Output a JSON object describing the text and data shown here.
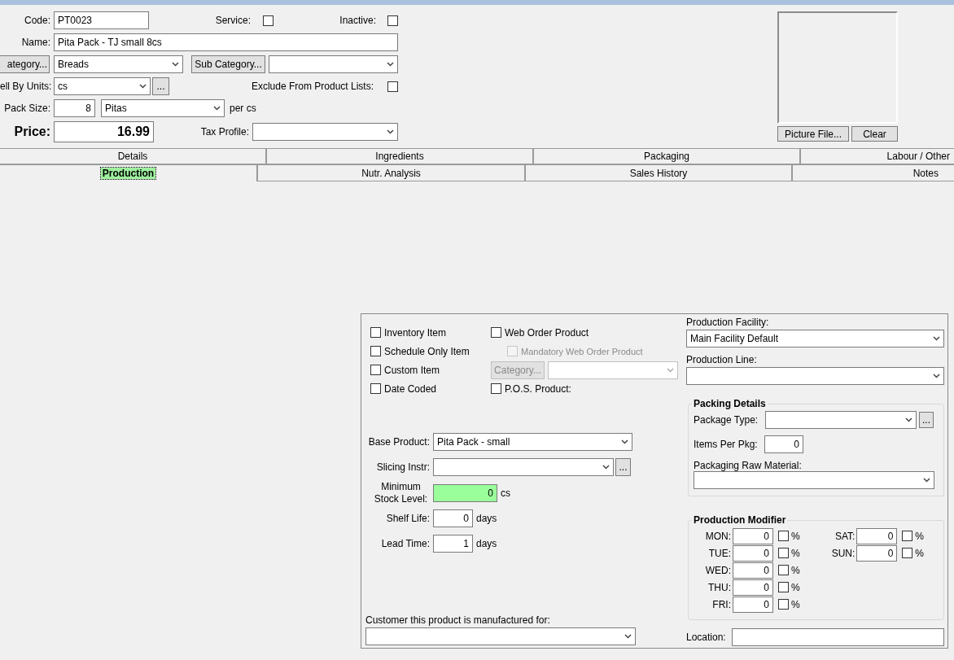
{
  "header": {
    "code": {
      "label": "Code:",
      "value": "PT0023"
    },
    "service": {
      "label": "Service:",
      "checked": false
    },
    "inactive": {
      "label": "Inactive:",
      "checked": false
    },
    "name": {
      "label": "Name:",
      "value": "Pita Pack - TJ small 8cs"
    },
    "category": {
      "button": "ategory...",
      "value": "Breads"
    },
    "sub_category": {
      "button": "Sub Category..."
    },
    "sell_by_units": {
      "label": "ell By Units:",
      "value": "cs",
      "button": "..."
    },
    "exclude": {
      "label": "Exclude From Product Lists:",
      "checked": false
    },
    "pack_size": {
      "label": "Pack Size:",
      "value": "8",
      "unit": "Pitas",
      "suffix": "per cs"
    },
    "price": {
      "label": "Price:",
      "value": "16.99"
    },
    "tax_profile": {
      "label": "Tax Profile:"
    }
  },
  "picture": {
    "buttons": [
      "Picture File...",
      "Clear"
    ]
  },
  "tab_rows": [
    [
      {
        "label": "Details",
        "selected": false
      },
      {
        "label": "Ingredients",
        "selected": false
      },
      {
        "label": "Packaging",
        "selected": false
      },
      {
        "label": "Labour / Other",
        "selected": false
      }
    ],
    [
      {
        "label": "Production",
        "selected": true
      },
      {
        "label": "Nutr. Analysis",
        "selected": false
      },
      {
        "label": "Sales History",
        "selected": false
      },
      {
        "label": "Notes",
        "selected": false
      }
    ]
  ],
  "production": {
    "left_checks": [
      {
        "label": "Inventory Item",
        "checked": false
      },
      {
        "label": "Schedule Only Item",
        "checked": false
      },
      {
        "label": "Custom Item",
        "checked": false
      },
      {
        "label": "Date Coded",
        "checked": false
      }
    ],
    "web_order": {
      "label": "Web Order Product",
      "checked": false
    },
    "mandatory_web_order": {
      "label": "Mandatory Web Order Product",
      "checked": false,
      "disabled": true
    },
    "web_category": {
      "button": "Category...",
      "disabled": true
    },
    "pos": {
      "label": "P.O.S. Product:",
      "checked": false
    },
    "base_product": {
      "label": "Base Product:",
      "value": "Pita Pack - small"
    },
    "slicing": {
      "label": "Slicing Instr:",
      "button": "..."
    },
    "min_stock": {
      "label": "Minimum Stock Level:",
      "value": "0",
      "unit": "cs",
      "highlighted": true
    },
    "shelf_life": {
      "label": "Shelf Life:",
      "value": "0",
      "unit": "days"
    },
    "lead_time": {
      "label": "Lead Time:",
      "value": "1",
      "unit": "days"
    },
    "customer": {
      "label": "Customer this product is manufactured for:"
    },
    "facility": {
      "label": "Production Facility:",
      "value": "Main Facility Default"
    },
    "line": {
      "label": "Production Line:"
    },
    "packing": {
      "title": "Packing Details",
      "package_type": {
        "label": "Package Type:",
        "button": "..."
      },
      "items_per_pkg": {
        "label": "Items Per Pkg:",
        "value": "0"
      },
      "raw_material": {
        "label": "Packaging Raw Material:"
      }
    },
    "modifier": {
      "title": "Production Modifier",
      "columns": [
        [
          {
            "label": "MON:",
            "value": "0",
            "percent": false,
            "unit": "%"
          },
          {
            "label": "TUE:",
            "value": "0",
            "percent": false,
            "unit": "%"
          },
          {
            "label": "WED:",
            "value": "0",
            "percent": false,
            "unit": "%"
          },
          {
            "label": "THU:",
            "value": "0",
            "percent": false,
            "unit": "%"
          },
          {
            "label": "FRI:",
            "value": "0",
            "percent": false,
            "unit": "%"
          }
        ],
        [
          {
            "label": "SAT:",
            "value": "0",
            "percent": false,
            "unit": "%"
          },
          {
            "label": "SUN:",
            "value": "0",
            "percent": false,
            "unit": "%"
          }
        ]
      ]
    },
    "location": {
      "label": "Location:"
    }
  }
}
